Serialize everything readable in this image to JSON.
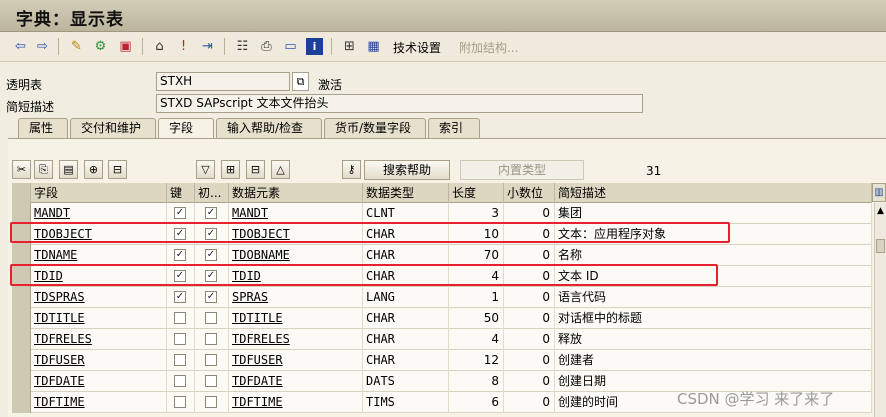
{
  "window": {
    "title": "字典：显示表"
  },
  "toolbar": {
    "icons": [
      "back-arrow-icon",
      "forward-arrow-icon",
      "edit-pencil-icon",
      "display-change-icon",
      "activate-icon",
      "where-used-icon",
      "info-pin-icon",
      "navigate-icon",
      "hierarchy-icon",
      "print-icon",
      "dictionary-icon",
      "info-icon",
      "layout-icon",
      "table-icon"
    ],
    "tech_settings": "技术设置",
    "append_structure": "附加结构..."
  },
  "header": {
    "table_label": "透明表",
    "table_value": "STXH",
    "status": "激活",
    "short_desc_label": "简短描述",
    "short_desc_value": "STXD SAPscript 文本文件抬头"
  },
  "tabs": [
    {
      "label": "属性"
    },
    {
      "label": "交付和维护"
    },
    {
      "label": "字段",
      "active": true
    },
    {
      "label": "输入帮助/检查"
    },
    {
      "label": "货币/数量字段"
    },
    {
      "label": "索引"
    }
  ],
  "fields_toolbar": {
    "search_help": "搜索帮助",
    "builtin_type": "内置类型",
    "count": "31"
  },
  "grid": {
    "headers": [
      "字段",
      "键",
      "初...",
      "数据元素",
      "数据类型",
      "长度",
      "小数位",
      "简短描述"
    ],
    "rows": [
      {
        "field": "MANDT",
        "key": true,
        "init": true,
        "element": "MANDT",
        "type": "CLNT",
        "len": "3",
        "dec": "0",
        "desc": "集团"
      },
      {
        "field": "TDOBJECT",
        "key": true,
        "init": true,
        "element": "TDOBJECT",
        "type": "CHAR",
        "len": "10",
        "dec": "0",
        "desc": "文本：应用程序对象"
      },
      {
        "field": "TDNAME",
        "key": true,
        "init": true,
        "element": "TDOBNAME",
        "type": "CHAR",
        "len": "70",
        "dec": "0",
        "desc": "名称"
      },
      {
        "field": "TDID",
        "key": true,
        "init": true,
        "element": "TDID",
        "type": "CHAR",
        "len": "4",
        "dec": "0",
        "desc": "文本 ID"
      },
      {
        "field": "TDSPRAS",
        "key": true,
        "init": true,
        "element": "SPRAS",
        "type": "LANG",
        "len": "1",
        "dec": "0",
        "desc": "语言代码"
      },
      {
        "field": "TDTITLE",
        "key": false,
        "init": false,
        "element": "TDTITLE",
        "type": "CHAR",
        "len": "50",
        "dec": "0",
        "desc": "对话框中的标题"
      },
      {
        "field": "TDFRELES",
        "key": false,
        "init": false,
        "element": "TDFRELES",
        "type": "CHAR",
        "len": "4",
        "dec": "0",
        "desc": "释放"
      },
      {
        "field": "TDFUSER",
        "key": false,
        "init": false,
        "element": "TDFUSER",
        "type": "CHAR",
        "len": "12",
        "dec": "0",
        "desc": "创建者"
      },
      {
        "field": "TDFDATE",
        "key": false,
        "init": false,
        "element": "TDFDATE",
        "type": "DATS",
        "len": "8",
        "dec": "0",
        "desc": "创建日期"
      },
      {
        "field": "TDFTIME",
        "key": false,
        "init": false,
        "element": "TDFTIME",
        "type": "TIMS",
        "len": "6",
        "dec": "0",
        "desc": "创建的时间"
      }
    ]
  },
  "watermark": "CSDN @学习 来了来了",
  "colors": {
    "highlight": "#e8212f"
  }
}
